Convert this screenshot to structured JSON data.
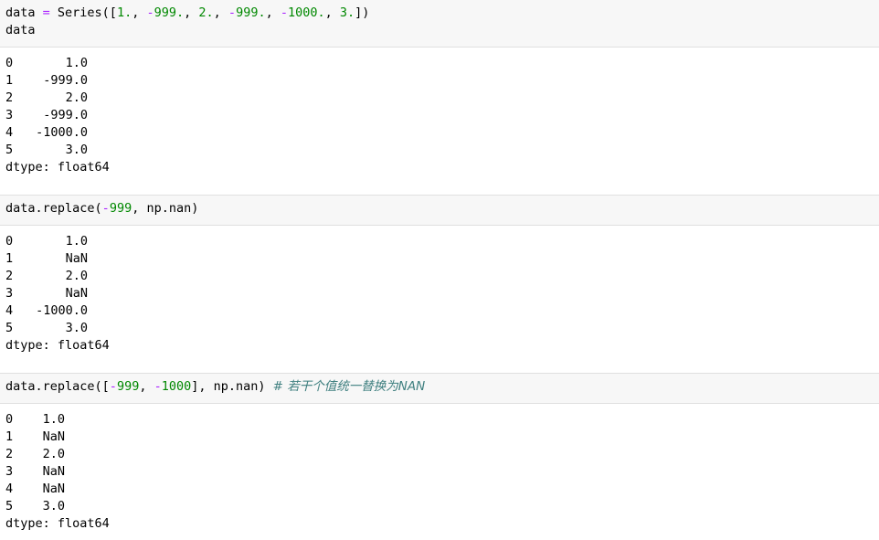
{
  "cells": [
    {
      "input": {
        "line1": {
          "t1": "data ",
          "t2": "=",
          "t3": " Series([",
          "t4": "1.",
          "t5": ", ",
          "t6": "-",
          "t7": "999.",
          "t8": ", ",
          "t9": "2.",
          "t10": ", ",
          "t11": "-",
          "t12": "999.",
          "t13": ", ",
          "t14": "-",
          "t15": "1000.",
          "t16": ", ",
          "t17": "3.",
          "t18": "])"
        },
        "line2": "data"
      },
      "output": {
        "rows": [
          {
            "index": "0",
            "value": "1.0"
          },
          {
            "index": "1",
            "value": "-999.0"
          },
          {
            "index": "2",
            "value": "2.0"
          },
          {
            "index": "3",
            "value": "-999.0"
          },
          {
            "index": "4",
            "value": "-1000.0"
          },
          {
            "index": "5",
            "value": "3.0"
          }
        ],
        "dtype": "dtype: float64"
      }
    },
    {
      "input": {
        "line1": {
          "t1": "data.replace(",
          "t2": "-",
          "t3": "999",
          "t4": ", np.nan)"
        }
      },
      "output": {
        "rows": [
          {
            "index": "0",
            "value": "1.0"
          },
          {
            "index": "1",
            "value": "NaN"
          },
          {
            "index": "2",
            "value": "2.0"
          },
          {
            "index": "3",
            "value": "NaN"
          },
          {
            "index": "4",
            "value": "-1000.0"
          },
          {
            "index": "5",
            "value": "3.0"
          }
        ],
        "dtype": "dtype: float64"
      }
    },
    {
      "input": {
        "line1": {
          "t1": "data.replace([",
          "t2": "-",
          "t3": "999",
          "t4": ", ",
          "t5": "-",
          "t6": "1000",
          "t7": "], np.nan) ",
          "t8": "# 若干个值统一替换为NAN"
        }
      },
      "output": {
        "rows": [
          {
            "index": "0",
            "value": "1.0"
          },
          {
            "index": "1",
            "value": "NaN"
          },
          {
            "index": "2",
            "value": "2.0"
          },
          {
            "index": "3",
            "value": "NaN"
          },
          {
            "index": "4",
            "value": "NaN"
          },
          {
            "index": "5",
            "value": "3.0"
          }
        ],
        "dtype": "dtype: float64"
      }
    }
  ],
  "colors": {
    "input_bg": "#f7f7f7",
    "operator": "#aa22ff",
    "number": "#008800",
    "comment": "#408080"
  }
}
